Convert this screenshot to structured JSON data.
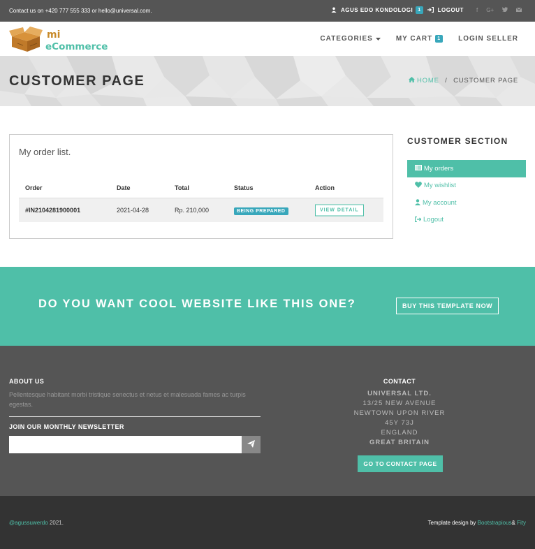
{
  "topbar": {
    "contact_text": "Contact us on +420 777 555 333 or hello@universal.com.",
    "user_name": "AGUS EDO KONDOLOGI",
    "user_badge": "1",
    "logout_label": "LOGOUT",
    "socials": [
      "f",
      "G+",
      "twitter",
      "mail"
    ]
  },
  "navbar": {
    "logo_line1": "mi",
    "logo_line2": "eCommerce",
    "categories_label": "CATEGORIES",
    "cart_label": "MY CART",
    "cart_badge": "1",
    "login_seller_label": "LOGIN SELLER"
  },
  "heading": {
    "title": "CUSTOMER PAGE",
    "breadcrumb_home": "HOME",
    "breadcrumb_sep": "/",
    "breadcrumb_current": "CUSTOMER PAGE"
  },
  "orders": {
    "lead": "My order list.",
    "columns": [
      "Order",
      "Date",
      "Total",
      "Status",
      "Action"
    ],
    "rows": [
      {
        "order": "#IN2104281900001",
        "date": "2021-04-28",
        "total": "Rp. 210,000",
        "status": "BEING PREPARED",
        "action": "VIEW DETAIL"
      }
    ]
  },
  "sidebar": {
    "title": "CUSTOMER SECTION",
    "items": [
      {
        "label": "My orders",
        "icon": "list-icon",
        "active": true
      },
      {
        "label": "My wishlist",
        "icon": "heart-icon",
        "active": false
      },
      {
        "label": "My account",
        "icon": "user-icon",
        "active": false
      },
      {
        "label": "Logout",
        "icon": "sign-out-icon",
        "active": false
      }
    ]
  },
  "banner": {
    "text": "DO YOU WANT COOL WEBSITE LIKE THIS ONE?",
    "button_label": "BUY THIS TEMPLATE NOW"
  },
  "footer": {
    "about_heading": "ABOUT US",
    "about_text": "Pellentesque habitant morbi tristique senectus et netus et malesuada fames ac turpis egestas.",
    "newsletter_heading": "JOIN OUR MONTHLY NEWSLETTER",
    "newsletter_placeholder": "",
    "contact_heading": "CONTACT",
    "address": [
      "UNIVERSAL LTD.",
      "13/25 NEW AVENUE",
      "NEWTOWN UPON RIVER",
      "45Y 73J",
      "ENGLAND",
      "GREAT BRITAIN"
    ],
    "contact_button": "GO TO CONTACT PAGE"
  },
  "copyright": {
    "handle": "@agussuwerdo",
    "year_text": " 2021.",
    "design_prefix": "Template design by ",
    "design_link1": "Bootstrapious",
    "design_amp": "& ",
    "design_link2": "Fity"
  },
  "colors": {
    "accent": "#4fbfa8",
    "badge": "#38a7bb",
    "topbar": "#555555",
    "footer": "#555555",
    "copyright": "#333333"
  }
}
